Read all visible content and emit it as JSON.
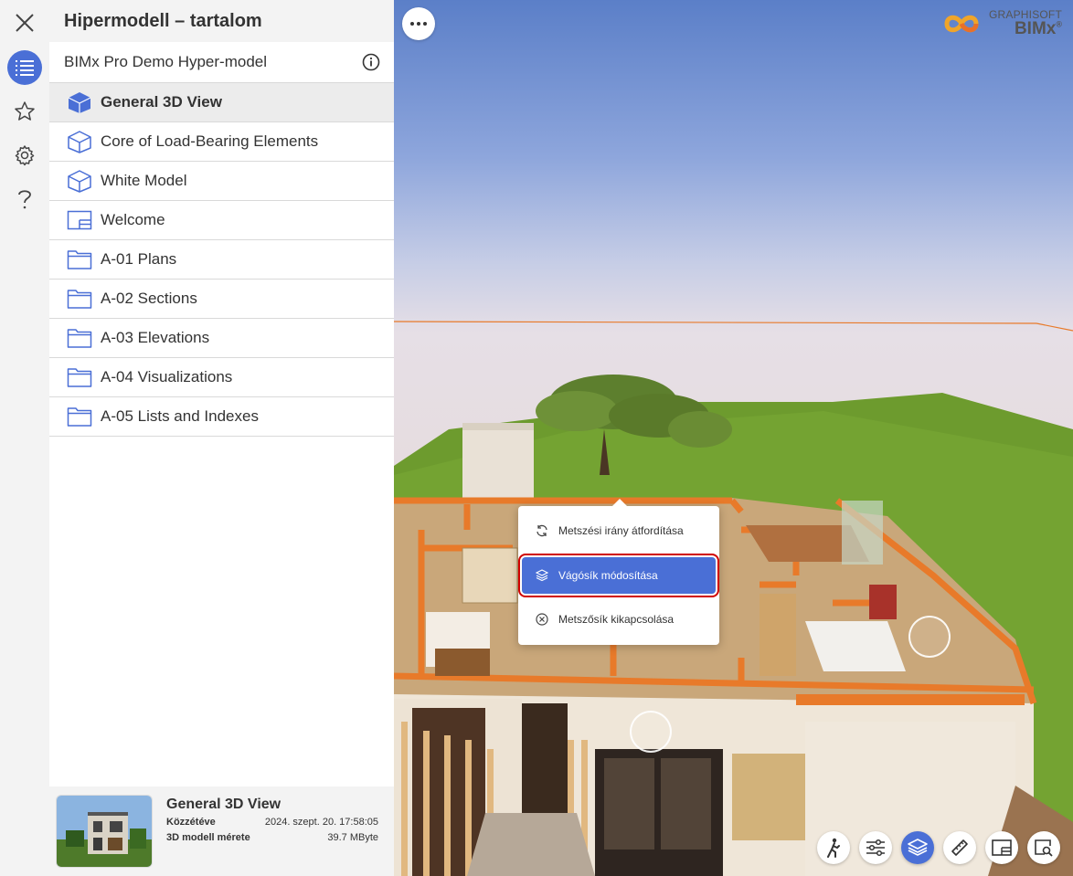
{
  "panel": {
    "title": "Hipermodell – tartalom",
    "model_name": "BIMx Pro Demo Hyper-model",
    "items": [
      {
        "label": "General 3D View",
        "icon": "cube-solid-icon",
        "selected": true
      },
      {
        "label": "Core of Load-Bearing Elements",
        "icon": "cube-outline-icon"
      },
      {
        "label": "White Model",
        "icon": "cube-outline-icon"
      },
      {
        "label": "Welcome",
        "icon": "layout-icon"
      },
      {
        "label": "A-01 Plans",
        "icon": "folder-icon"
      },
      {
        "label": "A-02 Sections",
        "icon": "folder-icon"
      },
      {
        "label": "A-03 Elevations",
        "icon": "folder-icon"
      },
      {
        "label": "A-04 Visualizations",
        "icon": "folder-icon"
      },
      {
        "label": "A-05 Lists and Indexes",
        "icon": "folder-icon"
      }
    ]
  },
  "footer": {
    "title": "General 3D View",
    "published_label": "Közzétéve",
    "published_value": "2024. szept. 20. 17:58:05",
    "size_label": "3D modell mérete",
    "size_value": "39.7 MByte"
  },
  "logo": {
    "brand": "GRAPHISOFT",
    "product": "BIMx",
    "reg": "®"
  },
  "popup": {
    "items": [
      {
        "label": "Metszési irány átfordítása",
        "icon": "refresh-icon"
      },
      {
        "label": "Vágósík módosítása",
        "icon": "section-plane-icon"
      },
      {
        "label": "Metszősík kikapcsolása",
        "icon": "close-circle-icon"
      }
    ]
  },
  "colors": {
    "accent": "#4a6fd6",
    "highlight_border": "#d00000",
    "wall_orange": "#e87a2a",
    "grass": "#6a9a2a"
  }
}
